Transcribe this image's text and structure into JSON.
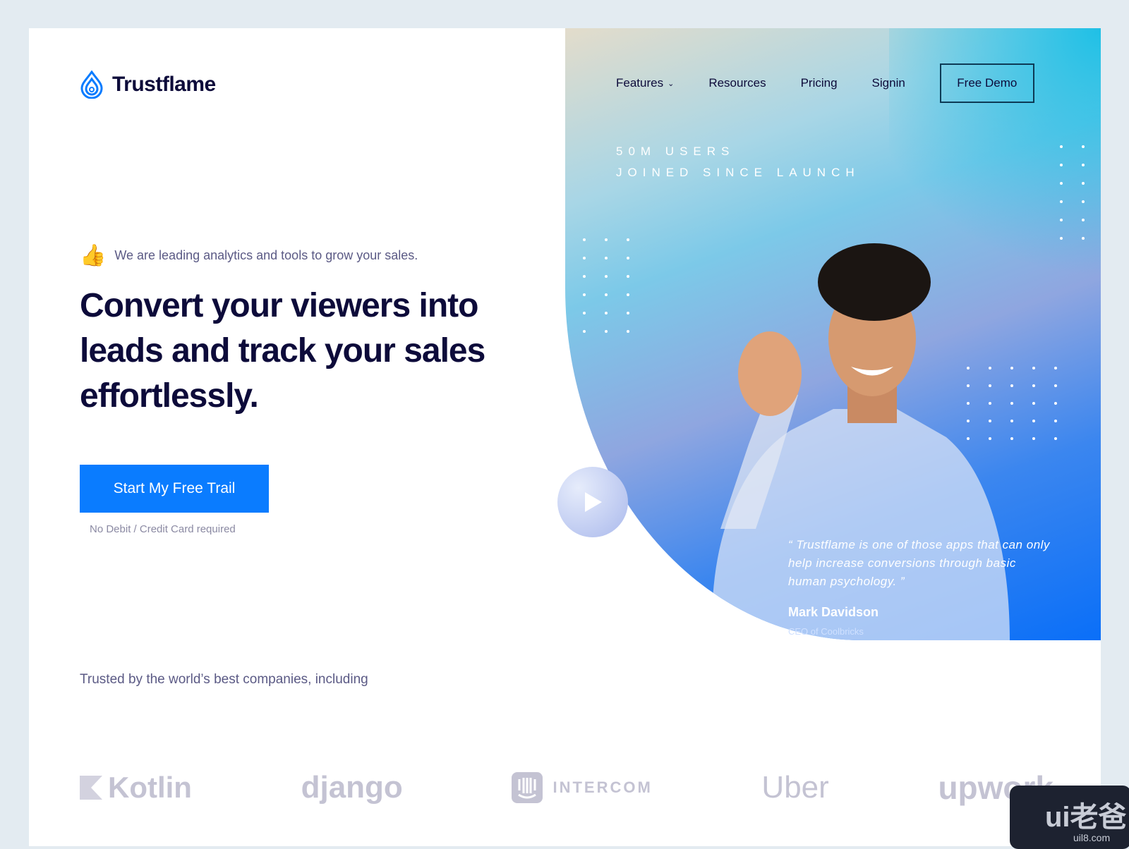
{
  "brand": {
    "name": "Trustflame",
    "accent": "#0a7cff",
    "text_color": "#0d0b3a"
  },
  "nav": {
    "items": [
      "Features",
      "Resources",
      "Pricing",
      "Signin"
    ],
    "demo": "Free Demo"
  },
  "stats": {
    "line1": "50M USERS",
    "line2": "JOINED SINCE LAUNCH"
  },
  "hero": {
    "tagline": "We are leading analytics and tools to grow your sales.",
    "headline": "Convert your viewers into leads and track your sales effortlessly.",
    "cta": "Start My Free Trail",
    "note": "No Debit / Credit Card required"
  },
  "testimonial": {
    "quote": "“ Trustflame is one of those apps that can only help increase conversions through basic human psychology. ”",
    "name": "Mark Davidson",
    "role": "CEO of Coolbricks"
  },
  "trusted": {
    "label": "Trusted by the world’s best companies, including",
    "logos": [
      "Kotlin",
      "django",
      "INTERCOM",
      "Uber",
      "upwork"
    ]
  },
  "watermark": {
    "main": "ui老爸",
    "sub": "uil8.com"
  }
}
